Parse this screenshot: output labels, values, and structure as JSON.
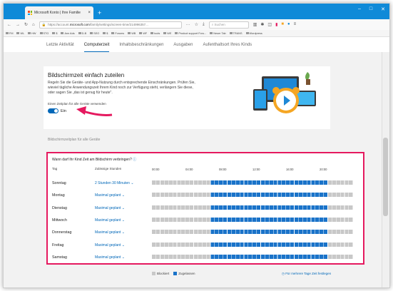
{
  "browser": {
    "tab_title": "Microsoft Konto | Ihre Familie",
    "url_prefix": "https://account.",
    "url_domain": "microsoft.com",
    "url_path": "/family/settings/screen-time/214996357...",
    "search_placeholder": "Suchen"
  },
  "bookmarks": [
    "FM",
    "WL",
    "HW",
    "STG",
    "$",
    "Ann Ads",
    "D-B",
    "SEO",
    "$",
    "Forums",
    "WB",
    "WF",
    "tools",
    "WE",
    "Product support Foru...",
    "Neuer Tab",
    "TRANS",
    "Wordpress"
  ],
  "page_tabs": [
    "Letzte Aktivität",
    "Computerzeit",
    "Inhaltsbeschränkungen",
    "Ausgaben",
    "Aufenthaltsort Ihres Kinds"
  ],
  "active_tab_index": 1,
  "intro": {
    "title": "Bildschirmzeit einfach zuteilen",
    "description": "Regeln Sie die Geräte- und App-Nutzung durch entsprechende Einschränkungen. Prüfen Sie, wieviel tägliche Anwendungszeit Ihrem Kind noch zur Verfügung steht, verlängern Sie diese, oder sagen Sie „das ist genug für heute\".",
    "toggle_label": "Einen Zeitplan für alle Geräte verwenden",
    "toggle_state": "Ein"
  },
  "schedule_heading": "Bildschirmzeitplan für alle Geräte",
  "schedule": {
    "question": "Wann darf Ihr Kind Zeit am Bildschirm verbringen?",
    "col_day": "Tag",
    "col_allowed": "Zulässige Stunden",
    "ticks": [
      "00:00",
      "04:00",
      "08:00",
      "12:00",
      "16:00",
      "20:00"
    ],
    "allowed_from_hour": 7,
    "allowed_to_hour": 21,
    "days": [
      {
        "day": "Sonntag",
        "allowed": "2 Stunden 30 Minuten"
      },
      {
        "day": "Montag",
        "allowed": "Maximal geplant"
      },
      {
        "day": "Dienstag",
        "allowed": "Maximal geplant"
      },
      {
        "day": "Mittwoch",
        "allowed": "Maximal geplant"
      },
      {
        "day": "Donnerstag",
        "allowed": "Maximal geplant"
      },
      {
        "day": "Freitag",
        "allowed": "Maximal geplant"
      },
      {
        "day": "Samstag",
        "allowed": "Maximal geplant"
      }
    ]
  },
  "legend": {
    "blocked": "Blockiert",
    "allowed": "Zugelassen"
  },
  "multi_day_link": "Für mehrere Tage Zeit festlegen",
  "colors": {
    "accent": "#0067b8",
    "highlight": "#e5195f",
    "blocked": "#c8c8c8",
    "allowed": "#1a73c9"
  }
}
